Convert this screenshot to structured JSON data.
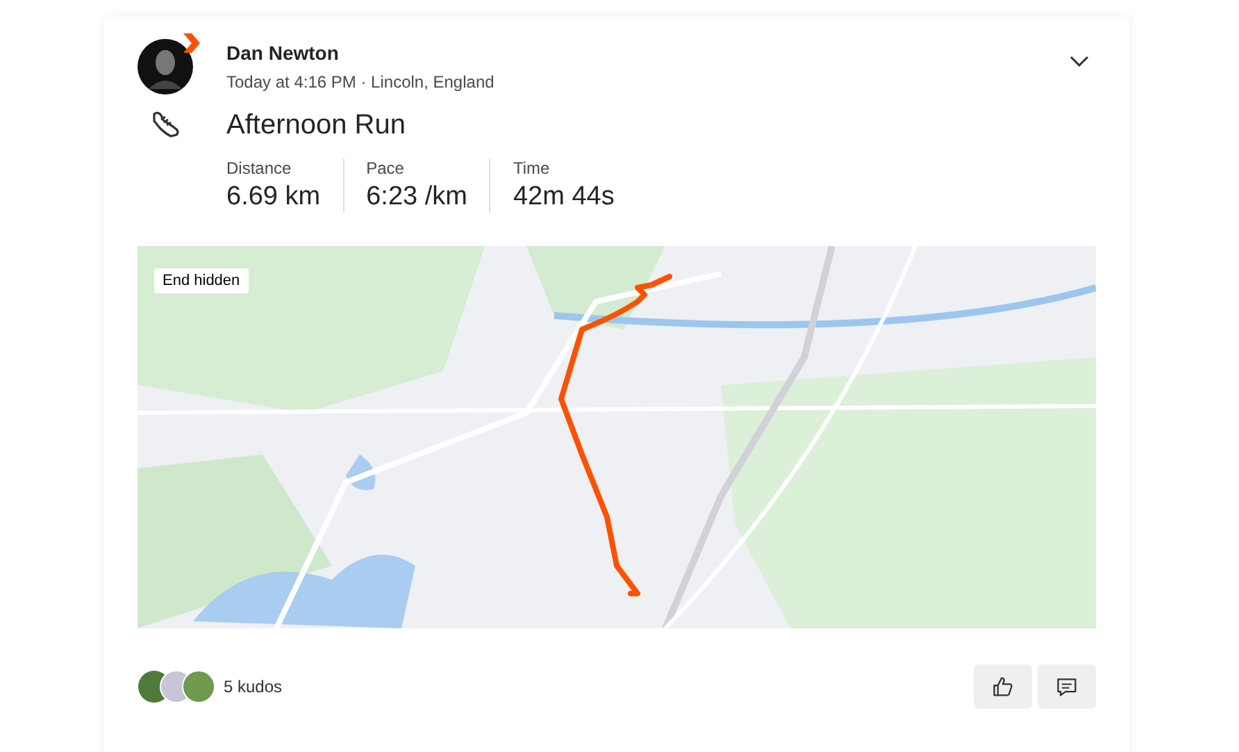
{
  "athlete": {
    "name": "Dan Newton",
    "meta": "Today at 4:16 PM · Lincoln, England"
  },
  "activity": {
    "title": "Afternoon Run"
  },
  "stats": [
    {
      "label": "Distance",
      "value": "6.69 km"
    },
    {
      "label": "Pace",
      "value": "6:23 /km"
    },
    {
      "label": "Time",
      "value": "42m 44s"
    }
  ],
  "map": {
    "kind": "picture",
    "badge": "End hidden"
  },
  "kudos": {
    "count_text": "5 kudos"
  }
}
